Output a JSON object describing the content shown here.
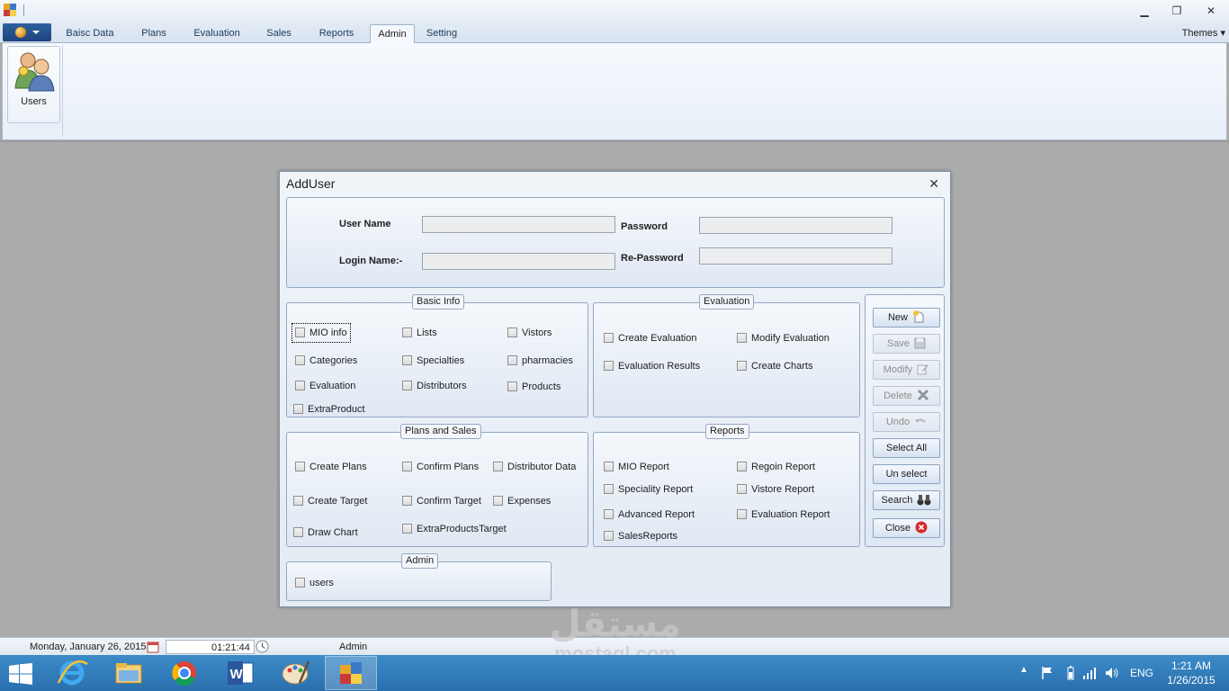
{
  "window": {
    "minimize_glyph": "▁",
    "restore_glyph": "❐",
    "close_glyph": "✕"
  },
  "ribbon": {
    "tabs": [
      "Baisc Data",
      "Plans",
      "Evaluation",
      "Sales",
      "Reports",
      "Admin",
      "Setting"
    ],
    "active_tab": "Admin",
    "themes_label": "Themes ▾",
    "group_button": {
      "label": "Users",
      "icon": "users-icon"
    }
  },
  "dialog": {
    "title": "AddUser",
    "close_glyph": "✕",
    "credentials": {
      "user_name_label": "User Name",
      "password_label": "Password",
      "login_name_label": "Login Name:-",
      "re_password_label": "Re-Password",
      "user_name_value": "",
      "password_value": "",
      "login_name_value": "",
      "re_password_value": ""
    },
    "groups": {
      "basic_info": {
        "title": "Basic Info",
        "items": [
          "MIO info",
          "Lists",
          "Vistors",
          "Categories",
          "Specialties",
          "pharmacies",
          "Evaluation",
          "Distributors",
          "Products",
          "ExtraProduct"
        ]
      },
      "evaluation": {
        "title": "Evaluation",
        "items": [
          "Create Evaluation",
          "Modify Evaluation",
          "Evaluation Results",
          "Create Charts"
        ]
      },
      "plans_and_sales": {
        "title": "Plans and Sales",
        "items": [
          "Create Plans",
          "Confirm Plans",
          "Distributor Data",
          "Create Target",
          "Confirm Target",
          "Expenses",
          "Draw Chart",
          "ExtraProductsTarget"
        ]
      },
      "reports": {
        "title": "Reports",
        "items": [
          "MIO Report",
          "Regoin Report",
          "Speciality Report",
          "Vistore Report",
          "Advanced Report",
          "Evaluation Report",
          "SalesReports"
        ]
      },
      "admin": {
        "title": "Admin",
        "items": [
          "users"
        ]
      }
    },
    "buttons": {
      "new": "New",
      "save": "Save",
      "modify": "Modify",
      "delete": "Delete",
      "undo": "Undo",
      "select_all": "Select All",
      "unselect": "Un select",
      "search": "Search",
      "close": "Close"
    }
  },
  "status_bar": {
    "date": "Monday, January 26, 2015",
    "time": "01:21:44",
    "user_label": "Admin"
  },
  "watermark": {
    "arabic": "مستقل",
    "latin": "mostaql.com"
  },
  "taskbar": {
    "apps": [
      "internet-explorer-icon",
      "file-explorer-icon",
      "chrome-icon",
      "word-icon",
      "paint-icon",
      "app-window-icon"
    ],
    "language": "ENG",
    "clock_time": "1:21 AM",
    "clock_date": "1/26/2015"
  },
  "colors": {
    "taskbar": "#2a6fae",
    "workspace": "#ababab",
    "dialog": "#e4ebf4"
  }
}
